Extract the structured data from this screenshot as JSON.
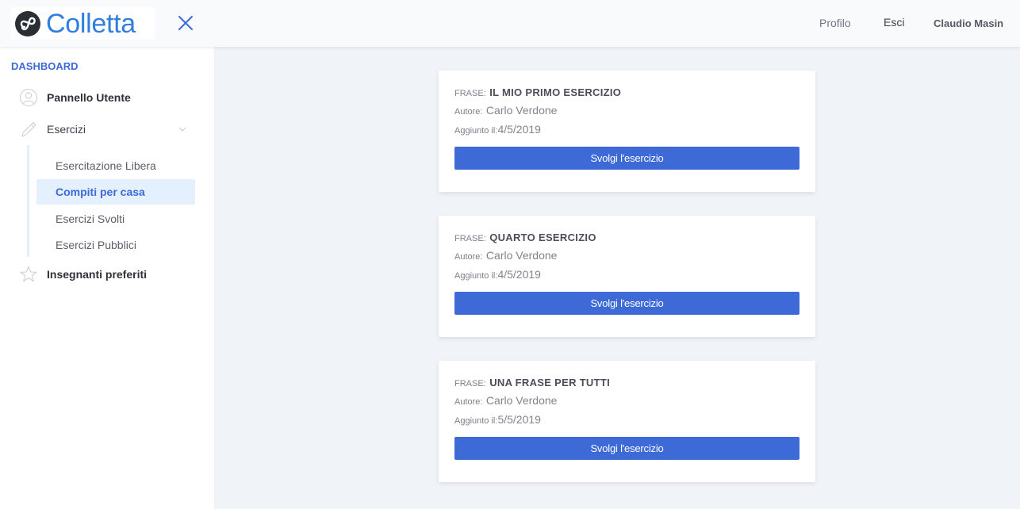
{
  "brand": {
    "name": "Colletta",
    "color": "#2f7fe0"
  },
  "header": {
    "menu_toggle_icon": "close-icon",
    "links": {
      "profile": "Profilo",
      "logout": "Esci"
    },
    "user_name": "Claudio Masin"
  },
  "sidebar": {
    "heading": "DASHBOARD",
    "items": [
      {
        "label": "Pannello Utente",
        "icon": "user-icon"
      },
      {
        "label": "Esercizi",
        "icon": "pencil-icon",
        "expanded": true,
        "children": [
          {
            "label": "Esercitazione Libera",
            "active": false
          },
          {
            "label": "Compiti per casa",
            "active": true
          },
          {
            "label": "Esercizi Svolti",
            "active": false
          },
          {
            "label": "Esercizi Pubblici",
            "active": false
          }
        ]
      },
      {
        "label": "Insegnanti preferiti",
        "icon": "star-icon"
      }
    ]
  },
  "labels": {
    "phrase": "FRASE:",
    "author": "Autore:",
    "added": "Aggiunto il:"
  },
  "exercises": [
    {
      "title": "IL MIO PRIMO ESERCIZIO",
      "author": "Carlo Verdone",
      "date": "4/5/2019",
      "button": "Svolgi l'esercizio"
    },
    {
      "title": "QUARTO ESERCIZIO",
      "author": "Carlo Verdone",
      "date": "4/5/2019",
      "button": "Svolgi l'esercizio"
    },
    {
      "title": "UNA FRASE PER TUTTI",
      "author": "Carlo Verdone",
      "date": "5/5/2019",
      "button": "Svolgi l'esercizio"
    }
  ],
  "colors": {
    "accent": "#3d6ad6",
    "active_bg": "#e4f0fd",
    "page_bg": "#f0f3f7"
  }
}
